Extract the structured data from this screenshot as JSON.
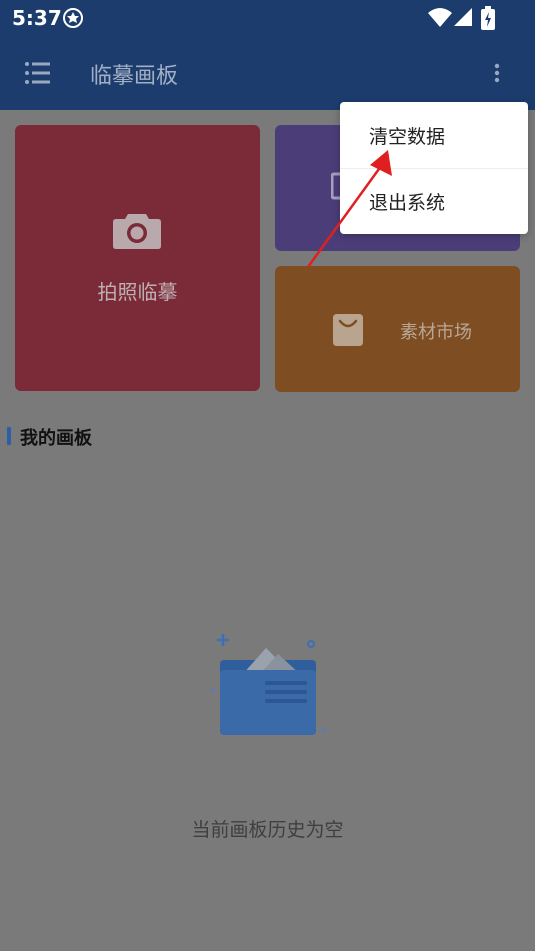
{
  "status_bar": {
    "time": "5:37",
    "icons": [
      "shield-icon",
      "wifi-icon",
      "signal-icon",
      "battery-charging-icon"
    ]
  },
  "toolbar": {
    "title": "临摹画板",
    "menu_icon": "menu-list-icon",
    "more_icon": "more-vertical-icon"
  },
  "cards": {
    "photo": {
      "label": "拍照临摹",
      "icon": "camera-icon",
      "color": "#7b2a38"
    },
    "purple": {
      "label": "",
      "icon": "image-icon",
      "color": "#4b3d78"
    },
    "material": {
      "label": "素材市场",
      "icon": "shopping-bag-icon",
      "color": "#7e4d22"
    }
  },
  "section": {
    "title": "我的画板",
    "accent": "#2d5ea8"
  },
  "empty_state": {
    "text": "当前画板历史为空",
    "icon": "empty-folder-illustration"
  },
  "popup_menu": {
    "items": [
      {
        "label": "清空数据"
      },
      {
        "label": "退出系统"
      }
    ]
  },
  "annotation": {
    "arrow_color": "#e02020"
  }
}
